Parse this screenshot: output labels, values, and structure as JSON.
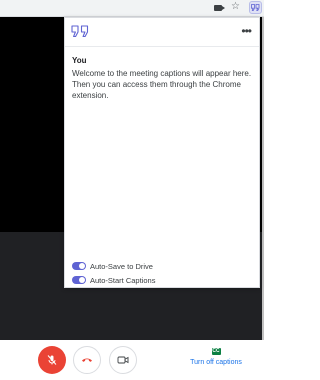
{
  "browser": {
    "icons": [
      "camera-icon",
      "star-icon",
      "extension-captions-icon"
    ]
  },
  "popup": {
    "speaker": "You",
    "caption": "Welcome to the meeting captions will appear here. Then you can access them through the Chrome extension.",
    "menu_icon": "more-options-icon",
    "settings": [
      {
        "label": "Auto-Save to Drive",
        "enabled": true
      },
      {
        "label": "Auto-Start Captions",
        "enabled": true
      }
    ]
  },
  "controls": {
    "captions_label": "Turn off captions",
    "captions_icon_text": "CC"
  },
  "colors": {
    "accent": "#5f63d3",
    "mic_off": "#ea4335",
    "link": "#1a73e8",
    "cc_green": "#0b8043",
    "meeting_bg": "#000000"
  }
}
